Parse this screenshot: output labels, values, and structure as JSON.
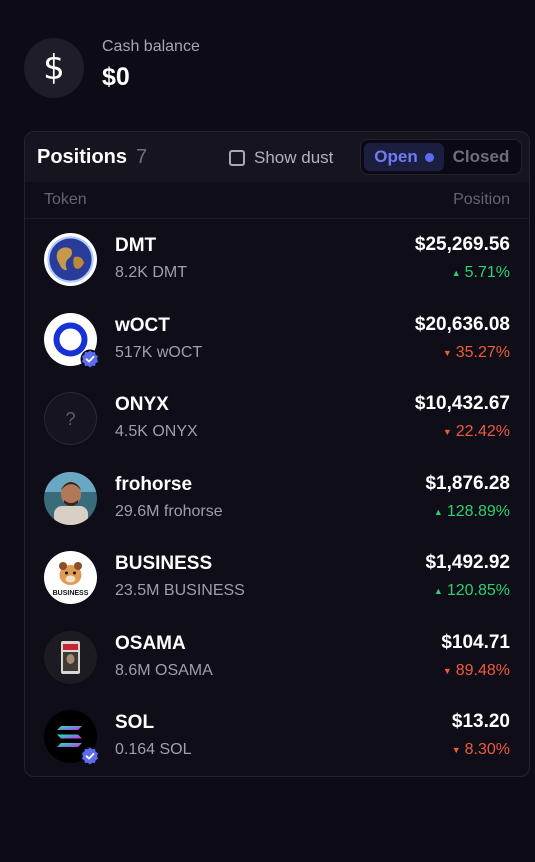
{
  "cash": {
    "icon": "dollar-icon",
    "icon_glyph": "$",
    "label": "Cash balance",
    "value": "$0"
  },
  "positions": {
    "title": "Positions",
    "count": "7",
    "show_dust_label": "Show dust",
    "show_dust_checked": false,
    "tabs": {
      "open": "Open",
      "closed": "Closed",
      "selected": "Open"
    },
    "columns": {
      "token": "Token",
      "position": "Position"
    },
    "rows": [
      {
        "name": "DMT",
        "amount": "8.2K DMT",
        "value": "$25,269.56",
        "change": "5.71%",
        "direction": "up",
        "avatar": "globe-icon",
        "verified": false
      },
      {
        "name": "wOCT",
        "amount": "517K wOCT",
        "value": "$20,636.08",
        "change": "35.27%",
        "direction": "down",
        "avatar": "ring-logo-icon",
        "verified": true
      },
      {
        "name": "ONYX",
        "amount": "4.5K ONYX",
        "value": "$10,432.67",
        "change": "22.42%",
        "direction": "down",
        "avatar": "unknown-token-icon",
        "verified": false
      },
      {
        "name": "frohorse",
        "amount": "29.6M frohorse",
        "value": "$1,876.28",
        "change": "128.89%",
        "direction": "up",
        "avatar": "person-photo-icon",
        "verified": false
      },
      {
        "name": "BUSINESS",
        "amount": "23.5M BUSINESS",
        "value": "$1,492.92",
        "change": "120.85%",
        "direction": "up",
        "avatar": "business-dog-icon",
        "avatar_text": "BUSINESS",
        "verified": false
      },
      {
        "name": "OSAMA",
        "amount": "8.6M OSAMA",
        "value": "$104.71",
        "change": "89.48%",
        "direction": "down",
        "avatar": "card-photo-icon",
        "verified": false
      },
      {
        "name": "SOL",
        "amount": "0.164 SOL",
        "value": "$13.20",
        "change": "8.30%",
        "direction": "down",
        "avatar": "solana-logo-icon",
        "verified": true
      }
    ]
  },
  "colors": {
    "background": "#0c0b16",
    "up": "#2fd06e",
    "down": "#f15a3b",
    "accent": "#5b6cf0",
    "verified": "#5b6cf0"
  }
}
